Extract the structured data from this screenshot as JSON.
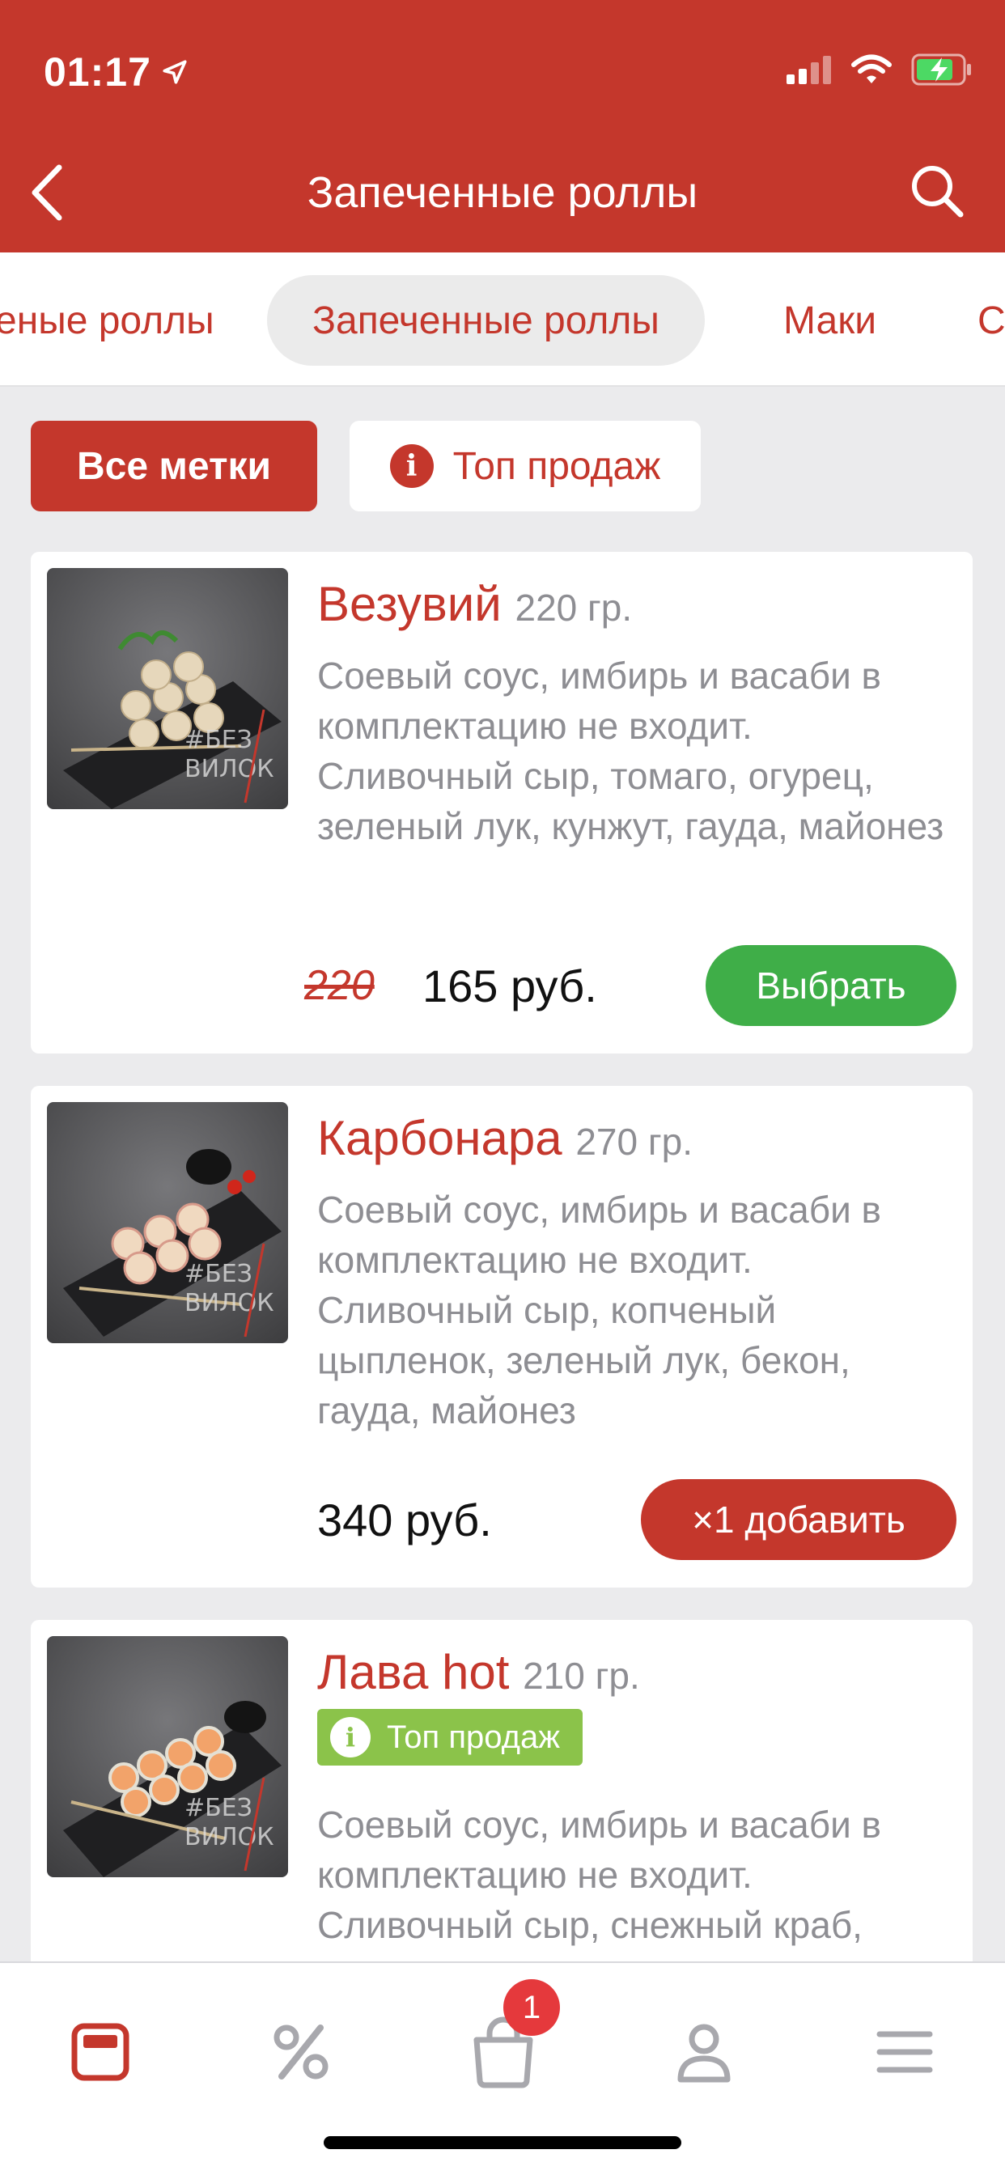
{
  "status_bar": {
    "time": "01:17"
  },
  "nav": {
    "title": "Запеченные роллы"
  },
  "category_tabs": [
    {
      "label": "еные роллы"
    },
    {
      "label": "Запеченные роллы"
    },
    {
      "label": "Маки"
    },
    {
      "label": "С"
    }
  ],
  "filters": {
    "all_tags": "Все метки",
    "top_sales": "Топ продаж"
  },
  "products": [
    {
      "name": "Везувий",
      "weight": "220 гр.",
      "description": "Соевый соус, имбирь и васаби в комплектацию не входит. Сливочный сыр, томаго, огурец, зеленый лук, кунжут, гауда, майонез",
      "old_price": "220",
      "price": "165 руб.",
      "button": "Выбрать"
    },
    {
      "name": "Карбонара",
      "weight": "270 гр.",
      "description": "Соевый соус, имбирь и васаби в комплектацию не входит. Сливочный сыр, копченый цыпленок, зеленый лук, бекон, гауда, майонез",
      "price": "340 руб.",
      "button": "×1 добавить"
    },
    {
      "name": "Лава hot",
      "weight": "210 гр.",
      "badge": "Топ продаж",
      "description": "Соевый соус, имбирь и васаби в комплектацию не входит. Сливочный сыр, снежный краб,"
    }
  ],
  "thumb_watermark": {
    "line1": "#БЕЗ",
    "line2": "ВИЛОК"
  },
  "tabbar": {
    "cart_count": "1"
  },
  "colors": {
    "brand": "#c4372c",
    "select_button": "#3fae48",
    "badge_green": "#8bc34a"
  }
}
